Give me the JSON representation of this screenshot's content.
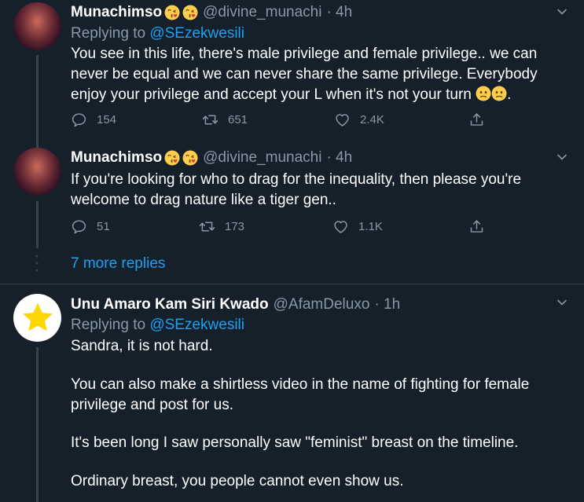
{
  "tweets": [
    {
      "name": "Munachimso",
      "handle": "@divine_munachi",
      "time": "· 4h",
      "replying_label": "Replying to",
      "replying_to": "@SEzekwesili",
      "text": "You see in this life, there's male privilege and female privilege.. we can never be equal and we can never share the same privilege. Everybody enjoy your privilege and accept your L when it's not your turn",
      "stats": {
        "replies": "154",
        "retweets": "651",
        "likes": "2.4K"
      }
    },
    {
      "name": "Munachimso",
      "handle": "@divine_munachi",
      "time": "· 4h",
      "text": "If you're looking for who to drag for the inequality, then please you're welcome to drag nature like a tiger gen..",
      "stats": {
        "replies": "51",
        "retweets": "173",
        "likes": "1.1K"
      }
    },
    {
      "name": "Unu Amaro Kam Siri Kwado",
      "handle": "@AfamDeluxo",
      "time": "· 1h",
      "replying_label": "Replying to",
      "replying_to": "@SEzekwesili",
      "paragraphs": [
        "Sandra, it is not hard.",
        "You can also make a shirtless video in the name of fighting for female privilege and post for us.",
        "It's been long I saw personally saw \"feminist\" breast on the timeline.",
        "Ordinary breast, you people cannot even show us."
      ]
    }
  ],
  "more_replies": "7 more replies",
  "icons": {
    "reply": "reply-icon",
    "retweet": "retweet-icon",
    "like": "heart-icon",
    "share": "share-icon",
    "more": "chevron-down-icon",
    "kiss_emoji": "face-blowing-kiss-emoji",
    "confused_emoji": "confused-face-emoji"
  },
  "colors": {
    "background": "#15202b",
    "secondary_text": "#8899a6",
    "link": "#1da1f2",
    "divider": "#38444d"
  }
}
